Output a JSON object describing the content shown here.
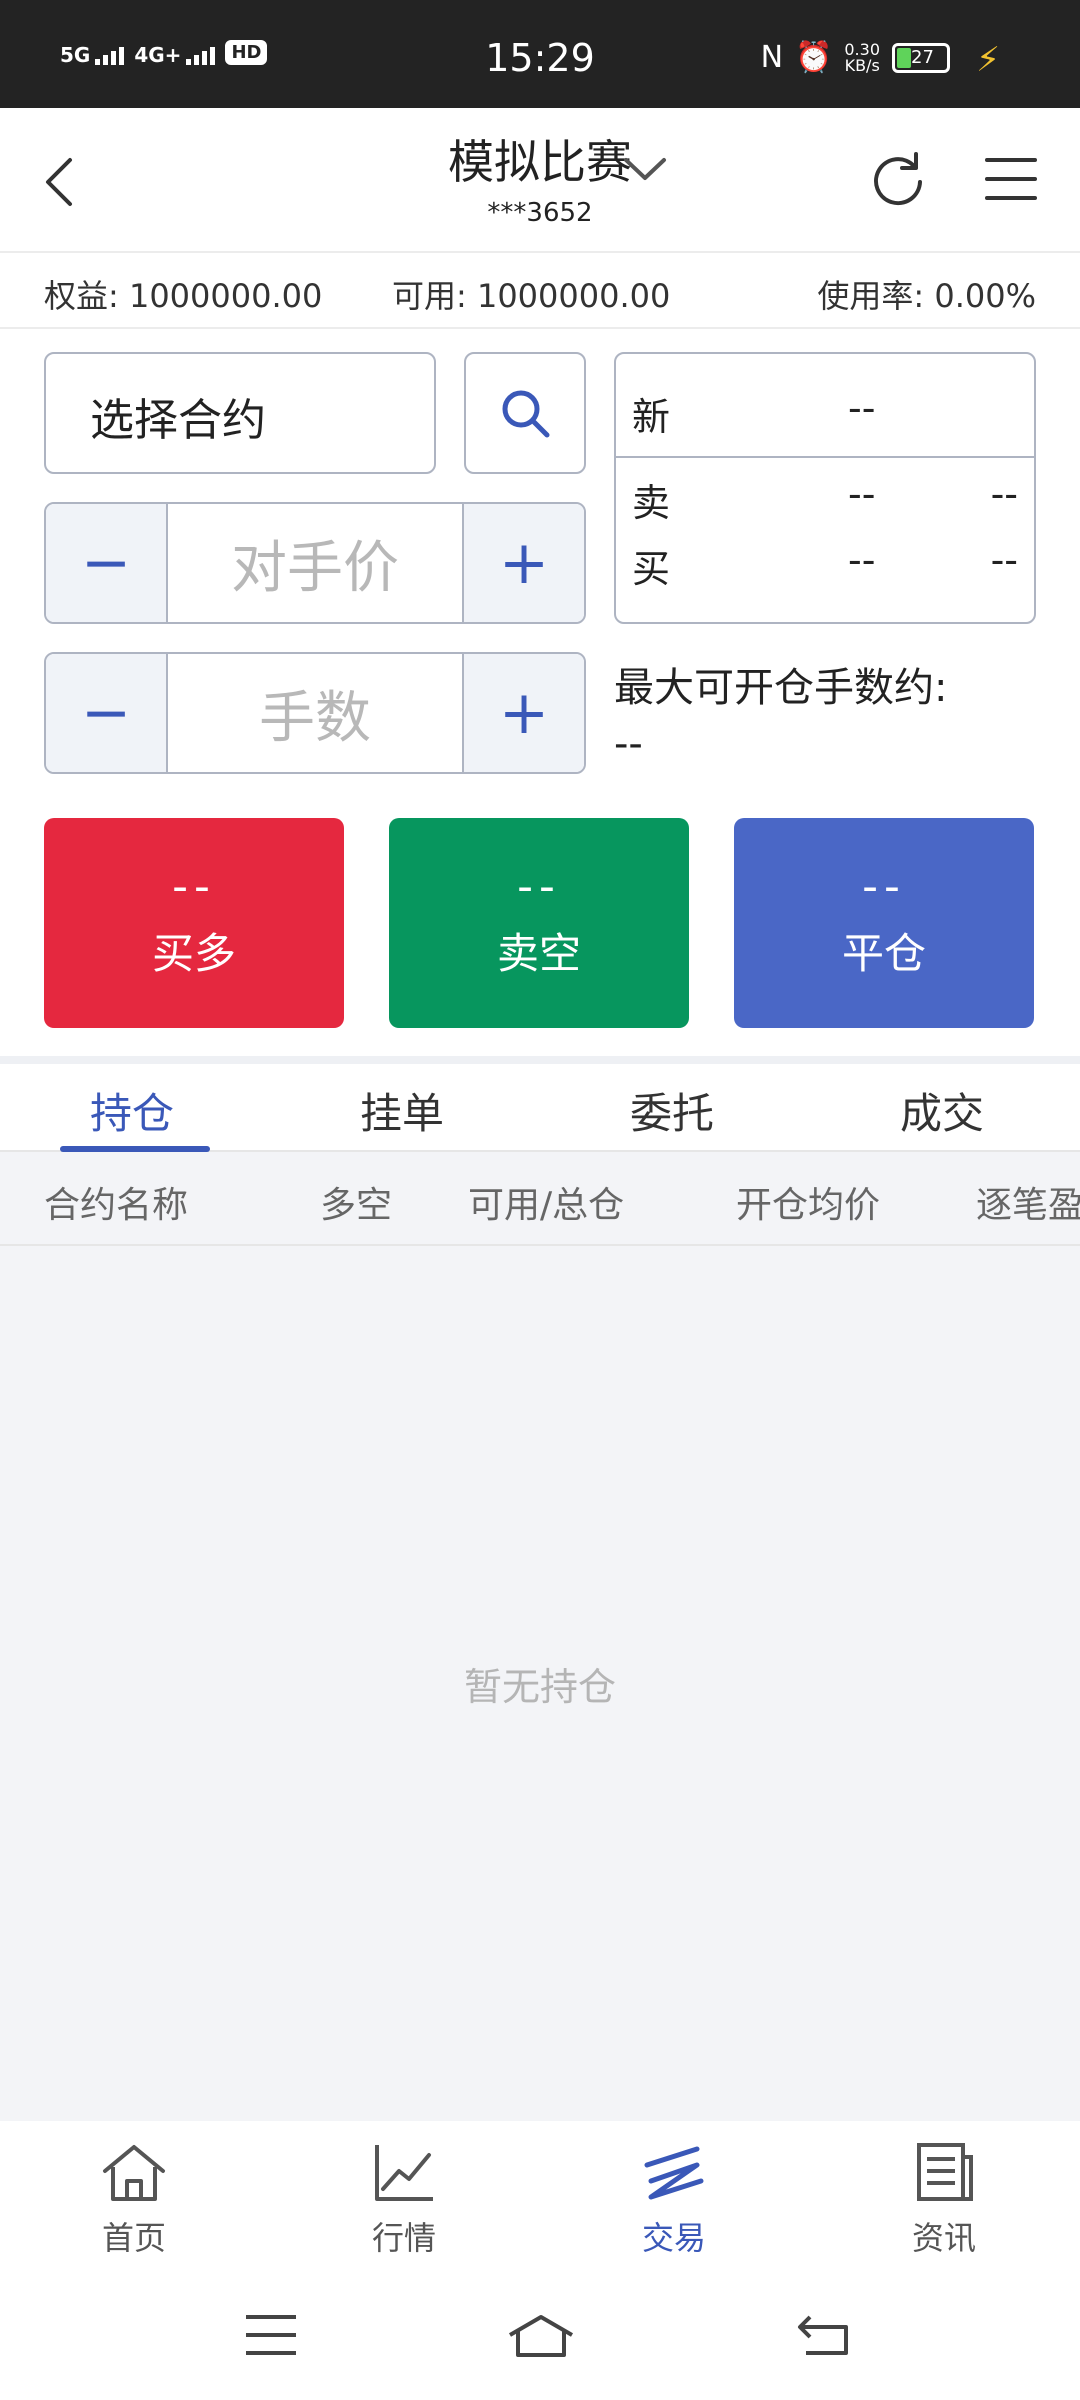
{
  "status_bar": {
    "signal1": "5G",
    "signal2": "4G+",
    "hd": "HD",
    "time": "15:29",
    "speed_value": "0.30",
    "speed_unit": "KB/s",
    "battery": "27"
  },
  "header": {
    "title": "模拟比赛",
    "account": "***3652"
  },
  "account_bar": {
    "equity": "权益: 1000000.00",
    "available": "可用: 1000000.00",
    "usage": "使用率: 0.00%"
  },
  "order_form": {
    "contract_label": "选择合约",
    "price_placeholder": "对手价",
    "qty_placeholder": "手数",
    "minus": "−",
    "plus": "+",
    "max_open_label": "最大可开仓手数约:",
    "max_open_value": "--"
  },
  "quote": {
    "new_label": "新",
    "new_value": "--",
    "sell_label": "卖",
    "sell_price": "--",
    "sell_vol": "--",
    "buy_label": "买",
    "buy_price": "--",
    "buy_vol": "--"
  },
  "actions": {
    "buy": {
      "price": "--",
      "label": "买多"
    },
    "sell": {
      "price": "--",
      "label": "卖空"
    },
    "close": {
      "price": "--",
      "label": "平仓"
    }
  },
  "tabs": [
    "持仓",
    "挂单",
    "委托",
    "成交"
  ],
  "columns": [
    "合约名称",
    "多空",
    "可用/总仓",
    "开仓均价",
    "逐笔盈"
  ],
  "empty_message": "暂无持仓",
  "bottom_nav": [
    "首页",
    "行情",
    "交易",
    "资讯"
  ],
  "colors": {
    "buy": "#e5283f",
    "sell": "#07965e",
    "close": "#4a67c6",
    "accent": "#3a58b8"
  }
}
